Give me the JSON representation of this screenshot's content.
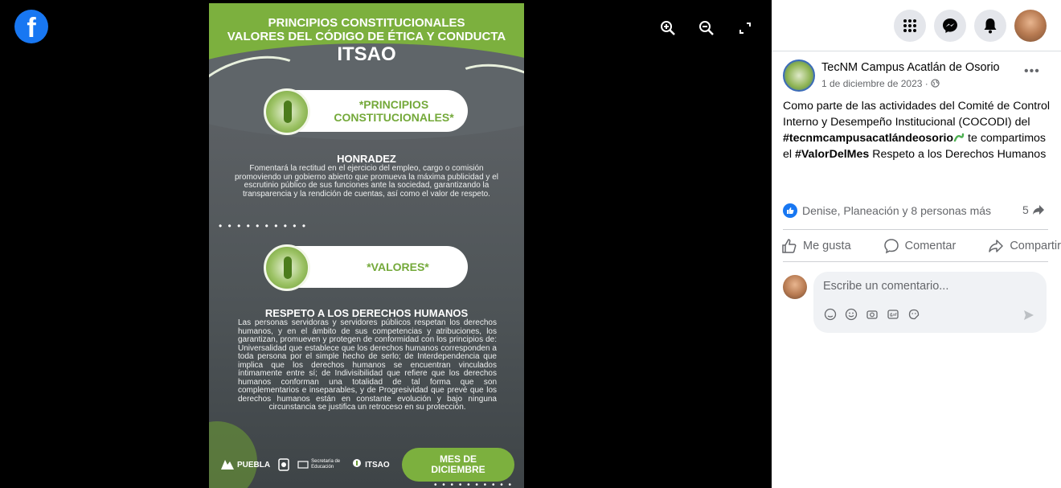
{
  "viewer": {
    "logo": "f",
    "tools": [
      "zoom-in-icon",
      "zoom-out-icon",
      "fullscreen-icon"
    ]
  },
  "poster": {
    "title_line1": "PRINCIPIOS CONSTITUCIONALES",
    "title_line2": "VALORES DEL CÓDIGO DE ÉTICA Y CONDUCTA",
    "title_line3": "ITSAO",
    "pill1_line1": "*PRINCIPIOS",
    "pill1_line2": "CONSTITUCIONALES*",
    "section1_title": "HONRADEZ",
    "section1_body": "Fomentará la rectitud en el ejercicio del empleo, cargo o comisión promoviendo un gobierno abierto que promueva la máxima publicidad y el escrutinio público de sus funciones ante la sociedad, garantizando la transparencia y la rendición de cuentas, así como el valor de respeto.",
    "dots": "• • • • • • • • • •",
    "pill2": "*VALORES*",
    "section2_title": "RESPETO A LOS DERECHOS HUMANOS",
    "section2_body": "Las personas servidoras y servidores públicos respetan los derechos humanos, y en el ámbito de sus competencias y atribuciones, los garantizan, promueven y protegen de conformidad con los principios de: Universalidad que establece que los derechos humanos corresponden a toda persona por el simple hecho de serlo; de Interdependencia que implica que los derechos humanos se encuentran vinculados íntimamente entre sí; de Indivisibilidad que refiere que los derechos humanos conforman una totalidad de tal forma que son complementarios e inseparables, y de Progresividad que prevé que los derechos humanos están en constante evolución y bajo ninguna circunstancia se justifica un retroceso en su protección.",
    "mes_line1": "MES DE",
    "mes_line2": "DICIEMBRE",
    "logo_puebla": "PUEBLA",
    "logo_itsao": "ITSAO",
    "logo_secretaria": "Secretaría de Educación"
  },
  "post": {
    "page_name": "TecNM Campus Acatlán de Osorio",
    "date": "1 de diciembre de 2023 · ",
    "text_part1": "Como parte de las actividades del Comité de Control Interno y Desempeño Institucional (COCODI) del ",
    "hashtag1": "#tecnmcampusacatlándeosorio",
    "text_part2": " te compartimos el ",
    "hashtag2": "#ValorDelMes",
    "text_part3": " Respeto a los Derechos Humanos",
    "reactions_text": "Denise, Planeación y 8 personas más",
    "shares_count": "5",
    "like_label": "Me gusta",
    "comment_label": "Comentar",
    "share_label": "Compartir",
    "comment_placeholder": "Escribe un comentario..."
  },
  "colors": {
    "brand": "#1877f2",
    "poster_green": "#7cb03e",
    "poster_gray": "#4f5558"
  }
}
